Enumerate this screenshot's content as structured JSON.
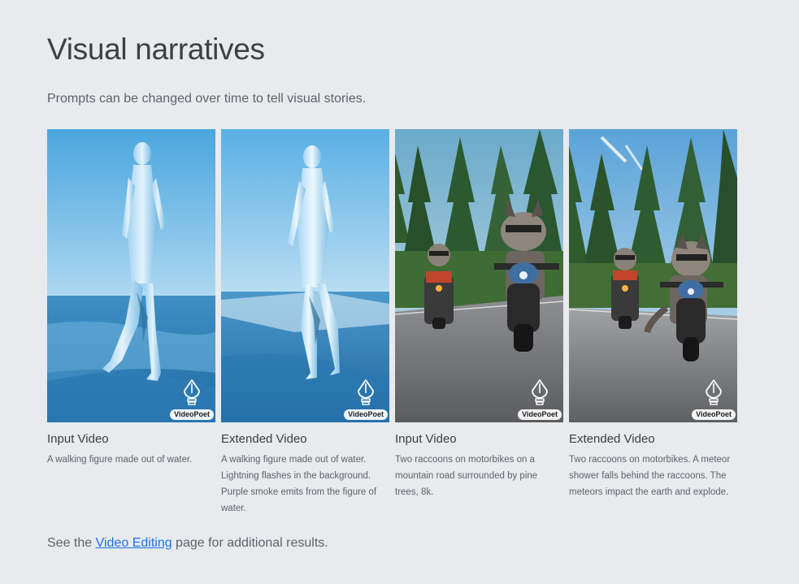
{
  "section": {
    "title": "Visual narratives",
    "subtitle": "Prompts can be changed over time to tell visual stories."
  },
  "videos": [
    {
      "label": "Input Video",
      "description": "A walking figure made out of water.",
      "badge": "VideoPoet",
      "scene": "water-figure"
    },
    {
      "label": "Extended Video",
      "description": "A walking figure made out of water. Lightning flashes in the background. Purple smoke emits from the figure of water.",
      "badge": "VideoPoet",
      "scene": "water-figure"
    },
    {
      "label": "Input Video",
      "description": "Two raccoons on motorbikes on a mountain road surrounded by pine trees, 8k.",
      "badge": "VideoPoet",
      "scene": "raccoons-motorbikes"
    },
    {
      "label": "Extended Video",
      "description": "Two raccoons on motorbikes. A meteor shower falls behind the raccoons. The meteors impact the earth and explode.",
      "badge": "VideoPoet",
      "scene": "raccoons-motorbikes"
    }
  ],
  "footer": {
    "prefix": "See the ",
    "link_text": "Video Editing",
    "suffix": " page for additional results."
  },
  "colors": {
    "background": "#e8eaed",
    "link": "#1a73e8",
    "text": "#3c4043"
  }
}
